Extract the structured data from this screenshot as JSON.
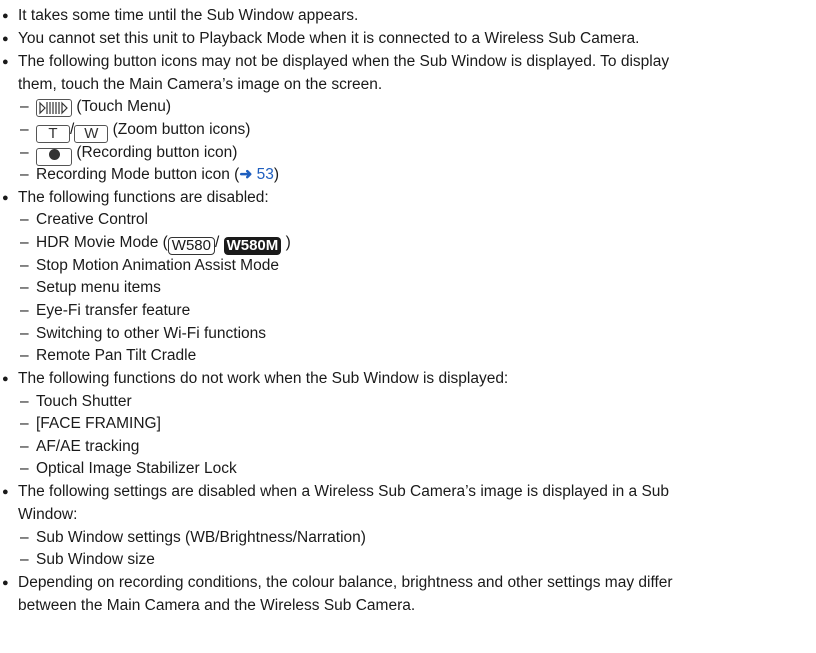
{
  "bullets": [
    {
      "text": "It takes some time until the Sub Window appears."
    },
    {
      "text": "You cannot set this unit to Playback Mode when it is connected to a Wireless Sub Camera."
    },
    {
      "line1": "The following button icons may not be displayed when the Sub Window is displayed. To display",
      "line2": "them, touch the Main Camera’s image on the screen."
    },
    {
      "text": "The following functions are disabled:"
    },
    {
      "text": "The following functions do not work when the Sub Window is displayed:"
    },
    {
      "line1": "The following settings are disabled when a Wireless Sub Camera’s image is displayed in a Sub",
      "line2": "Window:"
    },
    {
      "line1": "Depending on recording conditions, the colour balance, brightness and other settings may differ",
      "line2": "between the Main Camera and the Wireless Sub Camera."
    }
  ],
  "icons_list": {
    "touch_menu": "(Touch Menu)",
    "zoom_t": "T",
    "zoom_sep": "/",
    "zoom_w": "W",
    "zoom_label": "(Zoom button icons)",
    "recording_label": "(Recording button icon)",
    "rec_mode_label": "Recording Mode button icon (",
    "rec_mode_arrow": "➜",
    "rec_mode_page": "53",
    "rec_mode_close": ")"
  },
  "disabled_list": {
    "creative": "Creative Control",
    "hdr_prefix": "HDR Movie Mode (",
    "hdr_model1": "W580",
    "hdr_sep": "/",
    "hdr_model2": "W580M",
    "hdr_suffix": ")",
    "stop_motion": "Stop Motion Animation Assist Mode",
    "setup": "Setup menu items",
    "eyefi": "Eye-Fi transfer feature",
    "wifi": "Switching to other Wi-Fi functions",
    "cradle": "Remote Pan Tilt Cradle"
  },
  "not_work_list": [
    "Touch Shutter",
    "[FACE FRAMING]",
    "AF/AE tracking",
    "Optical Image Stabilizer Lock"
  ],
  "settings_list": [
    "Sub Window settings (WB/Brightness/Narration)",
    "Sub Window size"
  ],
  "symbols": {
    "bullet": "●",
    "dash": "–"
  }
}
